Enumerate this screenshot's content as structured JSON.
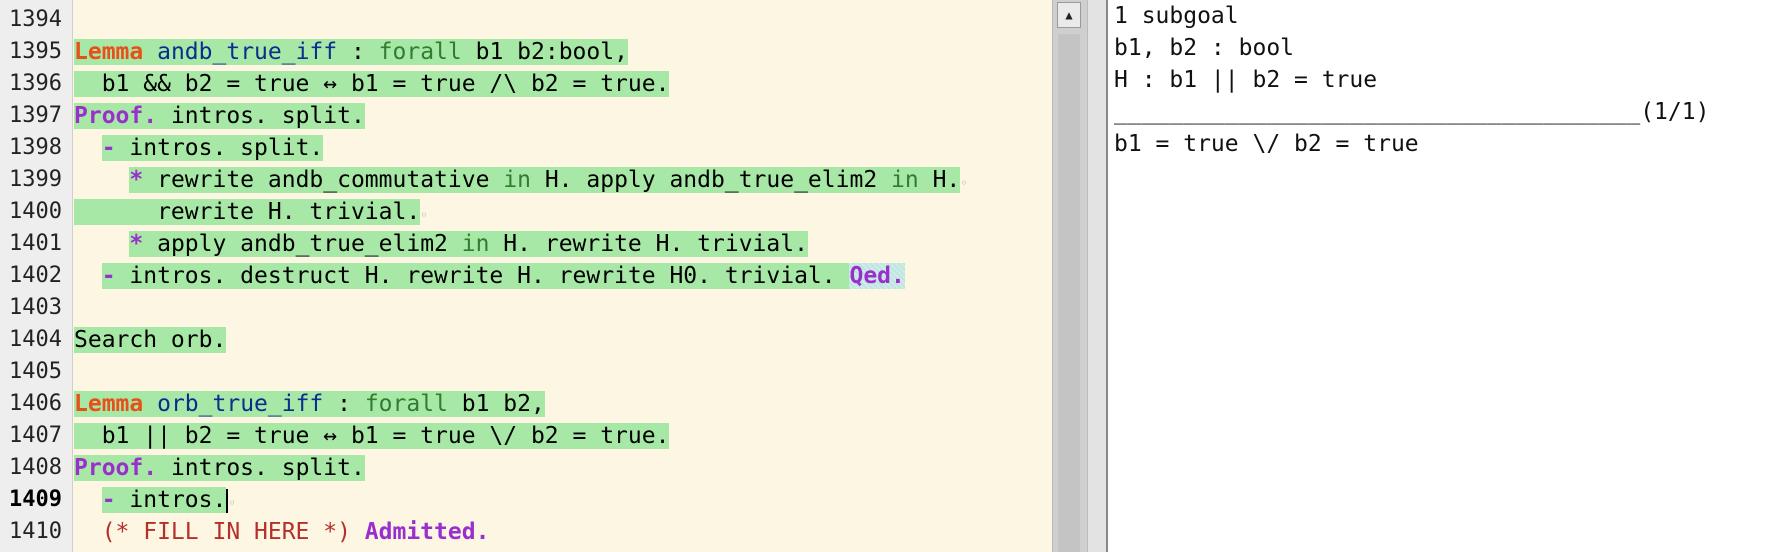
{
  "editor": {
    "lines": [
      {
        "n": "1394",
        "segments": [
          {
            "t": "",
            "c": "plain"
          }
        ]
      },
      {
        "n": "1395",
        "segments": [
          {
            "t": "Lemma",
            "c": "kw-lemma"
          },
          {
            "t": " ",
            "c": "plain"
          },
          {
            "t": "andb_true_iff",
            "c": "name"
          },
          {
            "t": " : ",
            "c": "plain"
          },
          {
            "t": "forall",
            "c": "kw"
          },
          {
            "t": " b1 b2:bool,",
            "c": "plain"
          }
        ]
      },
      {
        "n": "1396",
        "segments": [
          {
            "t": "  b1 && b2 = true ↔ b1 = true /\\ b2 = true.",
            "c": "plain"
          }
        ]
      },
      {
        "n": "1397",
        "segments": [
          {
            "t": "Proof.",
            "c": "kw-proof"
          },
          {
            "t": " intros. split.",
            "c": "plain"
          }
        ]
      },
      {
        "n": "1398",
        "segments": [
          {
            "t": "  ",
            "c": "plain"
          },
          {
            "t": "-",
            "c": "bullet"
          },
          {
            "t": " intros. split.",
            "c": "plain"
          }
        ]
      },
      {
        "n": "1399",
        "segments": [
          {
            "t": "    ",
            "c": "plain"
          },
          {
            "t": "*",
            "c": "bullet"
          },
          {
            "t": " rewrite andb_commutative ",
            "c": "plain"
          },
          {
            "t": "in",
            "c": "kw"
          },
          {
            "t": " H. apply andb_true_elim2 ",
            "c": "plain"
          },
          {
            "t": "in",
            "c": "kw"
          },
          {
            "t": " H.",
            "c": "plain"
          },
          {
            "t": "◦",
            "c": "dot"
          }
        ]
      },
      {
        "n": "1400",
        "segments": [
          {
            "t": "      rewrite H. trivial.",
            "c": "plain"
          },
          {
            "t": "◦",
            "c": "dot"
          }
        ]
      },
      {
        "n": "1401",
        "segments": [
          {
            "t": "    ",
            "c": "plain"
          },
          {
            "t": "*",
            "c": "bullet"
          },
          {
            "t": " apply andb_true_elim2 ",
            "c": "plain"
          },
          {
            "t": "in",
            "c": "kw"
          },
          {
            "t": " H. rewrite H. trivial.",
            "c": "plain"
          }
        ]
      },
      {
        "n": "1402",
        "segments": [
          {
            "t": "  ",
            "c": "plain"
          },
          {
            "t": "-",
            "c": "bullet"
          },
          {
            "t": " intros. destruct H. rewrite H. rewrite H0. trivial. ",
            "c": "plain"
          },
          {
            "t": "Qed.",
            "c": "kw-proof qed"
          }
        ]
      },
      {
        "n": "1403",
        "segments": [
          {
            "t": "",
            "c": "plain"
          }
        ]
      },
      {
        "n": "1404",
        "segments": [
          {
            "t": "Search orb.",
            "c": "plain"
          }
        ]
      },
      {
        "n": "1405",
        "segments": [
          {
            "t": "",
            "c": "plain"
          }
        ]
      },
      {
        "n": "1406",
        "segments": [
          {
            "t": "Lemma",
            "c": "kw-lemma"
          },
          {
            "t": " ",
            "c": "plain"
          },
          {
            "t": "orb_true_iff",
            "c": "name"
          },
          {
            "t": " : ",
            "c": "plain"
          },
          {
            "t": "forall",
            "c": "kw"
          },
          {
            "t": " b1 b2,",
            "c": "plain"
          }
        ]
      },
      {
        "n": "1407",
        "segments": [
          {
            "t": "  b1 || b2 = true ↔ b1 = true \\/ b2 = true.",
            "c": "plain"
          }
        ]
      },
      {
        "n": "1408",
        "segments": [
          {
            "t": "Proof.",
            "c": "kw-proof"
          },
          {
            "t": " intros. split.",
            "c": "plain"
          }
        ]
      },
      {
        "n": "1409",
        "segments": [
          {
            "t": "  ",
            "c": "plain"
          },
          {
            "t": "-",
            "c": "bullet"
          },
          {
            "t": " intros.",
            "c": "plain"
          }
        ]
      },
      {
        "n": "1410",
        "segments": [
          {
            "t": "  (* FILL IN HERE *) ",
            "c": "comment"
          },
          {
            "t": "Admitted.",
            "c": "kw-proof"
          }
        ]
      }
    ]
  },
  "goals": {
    "subgoal_count": "1 subgoal",
    "hyp1": "b1, b2 : bool",
    "hyp2": "H : b1 || b2 = true",
    "separator": "______________________________________(1/1)",
    "goal": "b1 = true \\/ b2 = true"
  },
  "scrollbar": {
    "up_arrow": "▲"
  }
}
